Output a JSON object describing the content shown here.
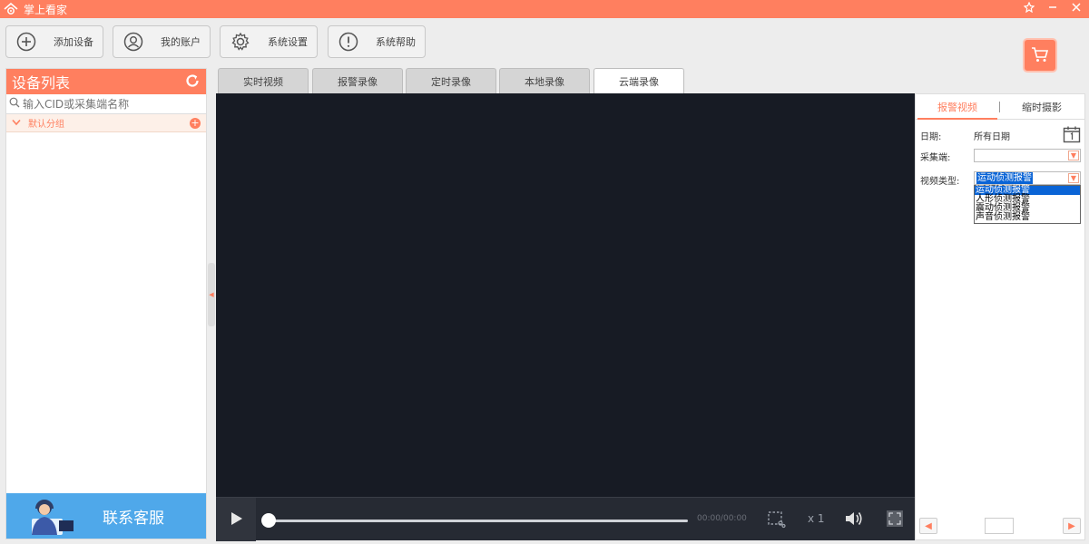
{
  "window": {
    "title": "掌上看家"
  },
  "toolbar": {
    "add_device": "添加设备",
    "my_account": "我的账户",
    "system_settings": "系统设置",
    "system_help": "系统帮助"
  },
  "sidebar": {
    "title": "设备列表",
    "search_placeholder": "输入CID或采集端名称",
    "group": "默认分组",
    "customer_service": "联系客服"
  },
  "tabs": [
    {
      "label": "实时视频"
    },
    {
      "label": "报警录像"
    },
    {
      "label": "定时录像"
    },
    {
      "label": "本地录像"
    },
    {
      "label": "云端录像",
      "active": true
    }
  ],
  "player": {
    "time": "00:00/00:00",
    "speed": "x 1"
  },
  "right_panel": {
    "tabs": [
      {
        "label": "报警视频",
        "active": true
      },
      {
        "label": "缩时摄影"
      }
    ],
    "date_label": "日期:",
    "date_value": "所有日期",
    "collector_label": "采集端:",
    "collector_value": "",
    "video_type_label": "视频类型:",
    "video_type_value": "运动侦测报警",
    "video_type_options": [
      "运动侦测报警",
      "人形侦测报警",
      "震动侦测报警",
      "声音侦测报警"
    ]
  },
  "colors": {
    "accent": "#ff7f5f",
    "video_bg": "#171b24",
    "selection": "#0a64d6"
  }
}
